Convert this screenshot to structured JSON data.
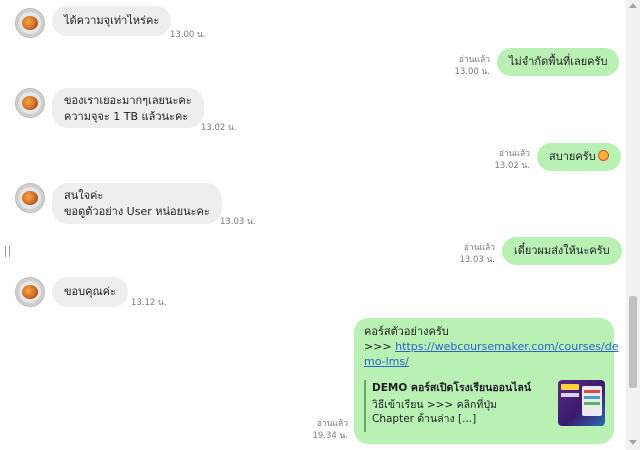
{
  "messages": {
    "m1": {
      "text": "ได้ความจุเท่าไหร่คะ",
      "time": "13.00 น."
    },
    "m2": {
      "read": "อ่านแล้ว",
      "time": "13.00 น.",
      "text": "ไม่จำกัดพื้นที่เลยครับ"
    },
    "m3": {
      "text": "ของเราเยอะมากๆเลยนะคะ\nความจุจะ 1 TB  แล้วนะคะ",
      "time": "13.02 น."
    },
    "m4": {
      "read": "อ่านแล้ว",
      "time": "13.02 น.",
      "text": "สบายครับ"
    },
    "m5": {
      "text": "สนใจค่ะ\nขอดูตัวอย่าง User หน่อยนะคะ",
      "time": "13.03 น."
    },
    "m6": {
      "read": "อ่านแล้ว",
      "time": "13.03 น.",
      "text": "เดี๋ยวผมส่งให้นะครับ"
    },
    "m7": {
      "text": "ขอบคุณค่ะ",
      "time": "13.12 น."
    },
    "m8": {
      "read": "อ่านแล้ว",
      "time": "19.34 น.",
      "line1": "คอร์สตัวอย่างครับ",
      "prefix": ">>> ",
      "link_part1": "https://webcoursemaker.com/courses/de",
      "link_part2": "mo-lms/",
      "preview_title": "DEMO คอร์สเปิดโรงเรียนออนไลน์",
      "preview_desc": "วิธีเข้าเรียน >>> คลิกที่ปุ่ม Chapter ด้านล่าง [...]"
    }
  },
  "icons": {
    "avatar": "avatar-food-photo",
    "emoji": "smiling-face-emoji",
    "scroll_up": "scroll-up-arrow",
    "scroll_down": "scroll-down-arrow"
  },
  "colors": {
    "incoming_bubble": "#eeeeee",
    "outgoing_bubble": "#b9f1b5",
    "link": "#2a64c8"
  }
}
